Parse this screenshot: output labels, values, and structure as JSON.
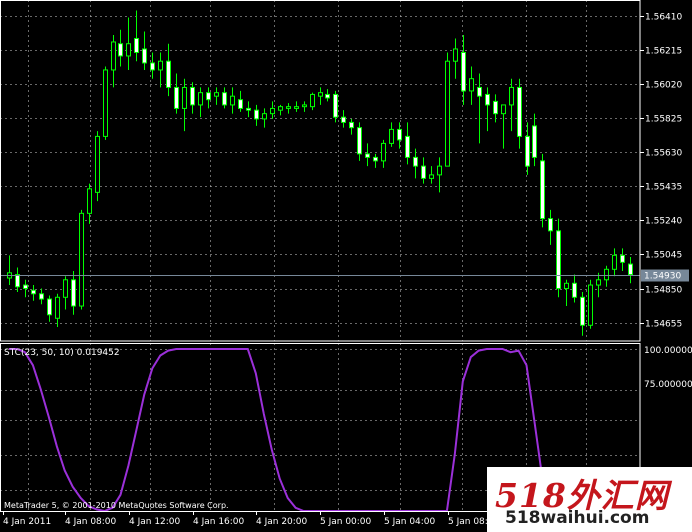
{
  "colors": {
    "background": "#000000",
    "grid": "#c0c0c0",
    "frame": "#ffffff",
    "candle": "#00ff00",
    "indicator_line": "#9b30d9",
    "current_price_line": "#778899",
    "current_price_tag_bg": "#778899",
    "watermark_red": "#c4161c"
  },
  "price_axis": {
    "labels": [
      "1.56410",
      "1.56215",
      "1.56020",
      "1.55825",
      "1.55630",
      "1.55435",
      "1.55240",
      "1.55045",
      "1.54850",
      "1.54655"
    ],
    "current_price": "1.54930"
  },
  "time_axis": {
    "labels": [
      "4 Jan 2011",
      "4 Jan 08:00",
      "4 Jan 12:00",
      "4 Jan 16:00",
      "4 Jan 20:00",
      "5 Jan 00:00",
      "5 Jan 04:00",
      "5 Jan 08:00"
    ]
  },
  "indicator": {
    "title": "STC(23, 50, 10) 0.019452",
    "axis_labels": [
      "100.000000",
      "75.000000"
    ],
    "copyright": "MetaTrader 5, © 2001-2010 MetaQuotes Software Corp."
  },
  "watermark": {
    "main_text": "518外汇网",
    "url_text": "518waihui.com"
  },
  "chart_data": {
    "type": "candlestick",
    "price_range": [
      1.5455,
      1.565
    ],
    "indicator_range": [
      0,
      100
    ],
    "candles": [
      {
        "o": 1.5491,
        "h": 1.5504,
        "l": 1.5487,
        "c": 1.5494
      },
      {
        "o": 1.5493,
        "h": 1.5497,
        "l": 1.5483,
        "c": 1.5486
      },
      {
        "o": 1.5487,
        "h": 1.549,
        "l": 1.548,
        "c": 1.5485
      },
      {
        "o": 1.5484,
        "h": 1.5487,
        "l": 1.5478,
        "c": 1.5482
      },
      {
        "o": 1.5482,
        "h": 1.5485,
        "l": 1.5476,
        "c": 1.5479
      },
      {
        "o": 1.5479,
        "h": 1.5481,
        "l": 1.5466,
        "c": 1.547
      },
      {
        "o": 1.5468,
        "h": 1.5482,
        "l": 1.5463,
        "c": 1.548
      },
      {
        "o": 1.548,
        "h": 1.5492,
        "l": 1.5473,
        "c": 1.549
      },
      {
        "o": 1.549,
        "h": 1.5495,
        "l": 1.547,
        "c": 1.5475
      },
      {
        "o": 1.5475,
        "h": 1.553,
        "l": 1.5473,
        "c": 1.5528
      },
      {
        "o": 1.5528,
        "h": 1.5545,
        "l": 1.5522,
        "c": 1.5542
      },
      {
        "o": 1.554,
        "h": 1.5575,
        "l": 1.5535,
        "c": 1.5572
      },
      {
        "o": 1.5572,
        "h": 1.5612,
        "l": 1.557,
        "c": 1.561
      },
      {
        "o": 1.561,
        "h": 1.563,
        "l": 1.56,
        "c": 1.5626
      },
      {
        "o": 1.5625,
        "h": 1.5633,
        "l": 1.5612,
        "c": 1.5618
      },
      {
        "o": 1.5618,
        "h": 1.564,
        "l": 1.561,
        "c": 1.5625
      },
      {
        "o": 1.5628,
        "h": 1.5644,
        "l": 1.5615,
        "c": 1.562
      },
      {
        "o": 1.5622,
        "h": 1.5632,
        "l": 1.561,
        "c": 1.5614
      },
      {
        "o": 1.5614,
        "h": 1.562,
        "l": 1.5605,
        "c": 1.561
      },
      {
        "o": 1.561,
        "h": 1.562,
        "l": 1.56,
        "c": 1.5615
      },
      {
        "o": 1.5615,
        "h": 1.5625,
        "l": 1.5595,
        "c": 1.56
      },
      {
        "o": 1.56,
        "h": 1.5608,
        "l": 1.5585,
        "c": 1.5588
      },
      {
        "o": 1.5588,
        "h": 1.5605,
        "l": 1.5575,
        "c": 1.56
      },
      {
        "o": 1.56,
        "h": 1.5603,
        "l": 1.5585,
        "c": 1.559
      },
      {
        "o": 1.559,
        "h": 1.56,
        "l": 1.5583,
        "c": 1.5597
      },
      {
        "o": 1.5597,
        "h": 1.56,
        "l": 1.5588,
        "c": 1.5593
      },
      {
        "o": 1.5595,
        "h": 1.56,
        "l": 1.559,
        "c": 1.5597
      },
      {
        "o": 1.5597,
        "h": 1.56,
        "l": 1.5588,
        "c": 1.559
      },
      {
        "o": 1.559,
        "h": 1.56,
        "l": 1.5585,
        "c": 1.5595
      },
      {
        "o": 1.5593,
        "h": 1.5598,
        "l": 1.5586,
        "c": 1.5588
      },
      {
        "o": 1.5588,
        "h": 1.5592,
        "l": 1.5583,
        "c": 1.5587
      },
      {
        "o": 1.5587,
        "h": 1.559,
        "l": 1.5578,
        "c": 1.5582
      },
      {
        "o": 1.5582,
        "h": 1.5588,
        "l": 1.5577,
        "c": 1.5585
      },
      {
        "o": 1.5585,
        "h": 1.5592,
        "l": 1.5582,
        "c": 1.5588
      },
      {
        "o": 1.5587,
        "h": 1.559,
        "l": 1.5584,
        "c": 1.5589
      },
      {
        "o": 1.5588,
        "h": 1.5591,
        "l": 1.5585,
        "c": 1.5589
      },
      {
        "o": 1.5588,
        "h": 1.5592,
        "l": 1.5586,
        "c": 1.5589
      },
      {
        "o": 1.5589,
        "h": 1.5592,
        "l": 1.5586,
        "c": 1.559
      },
      {
        "o": 1.5589,
        "h": 1.5597,
        "l": 1.5587,
        "c": 1.5596
      },
      {
        "o": 1.5595,
        "h": 1.56,
        "l": 1.559,
        "c": 1.5597
      },
      {
        "o": 1.5596,
        "h": 1.5599,
        "l": 1.5592,
        "c": 1.5594
      },
      {
        "o": 1.5596,
        "h": 1.5598,
        "l": 1.558,
        "c": 1.5583
      },
      {
        "o": 1.5583,
        "h": 1.5587,
        "l": 1.5577,
        "c": 1.558
      },
      {
        "o": 1.558,
        "h": 1.5582,
        "l": 1.5573,
        "c": 1.5577
      },
      {
        "o": 1.5577,
        "h": 1.558,
        "l": 1.5558,
        "c": 1.5562
      },
      {
        "o": 1.5562,
        "h": 1.5568,
        "l": 1.5555,
        "c": 1.556
      },
      {
        "o": 1.556,
        "h": 1.5562,
        "l": 1.5554,
        "c": 1.5558
      },
      {
        "o": 1.5558,
        "h": 1.557,
        "l": 1.5554,
        "c": 1.5568
      },
      {
        "o": 1.5568,
        "h": 1.558,
        "l": 1.5566,
        "c": 1.5576
      },
      {
        "o": 1.5576,
        "h": 1.558,
        "l": 1.5565,
        "c": 1.557
      },
      {
        "o": 1.5572,
        "h": 1.558,
        "l": 1.5556,
        "c": 1.556
      },
      {
        "o": 1.556,
        "h": 1.5565,
        "l": 1.5548,
        "c": 1.5555
      },
      {
        "o": 1.5555,
        "h": 1.556,
        "l": 1.5545,
        "c": 1.5548
      },
      {
        "o": 1.5548,
        "h": 1.5555,
        "l": 1.5545,
        "c": 1.555
      },
      {
        "o": 1.555,
        "h": 1.556,
        "l": 1.554,
        "c": 1.5555
      },
      {
        "o": 1.5555,
        "h": 1.562,
        "l": 1.5555,
        "c": 1.5615
      },
      {
        "o": 1.5615,
        "h": 1.5628,
        "l": 1.5605,
        "c": 1.5622
      },
      {
        "o": 1.562,
        "h": 1.563,
        "l": 1.559,
        "c": 1.5598
      },
      {
        "o": 1.5598,
        "h": 1.5612,
        "l": 1.559,
        "c": 1.5605
      },
      {
        "o": 1.56,
        "h": 1.5608,
        "l": 1.5568,
        "c": 1.5595
      },
      {
        "o": 1.5596,
        "h": 1.56,
        "l": 1.5575,
        "c": 1.559
      },
      {
        "o": 1.5592,
        "h": 1.5596,
        "l": 1.558,
        "c": 1.5585
      },
      {
        "o": 1.5585,
        "h": 1.559,
        "l": 1.5565,
        "c": 1.559
      },
      {
        "o": 1.559,
        "h": 1.5605,
        "l": 1.5575,
        "c": 1.56
      },
      {
        "o": 1.56,
        "h": 1.5605,
        "l": 1.5565,
        "c": 1.5572
      },
      {
        "o": 1.5572,
        "h": 1.558,
        "l": 1.555,
        "c": 1.5555
      },
      {
        "o": 1.5578,
        "h": 1.5585,
        "l": 1.5555,
        "c": 1.556
      },
      {
        "o": 1.5558,
        "h": 1.5562,
        "l": 1.552,
        "c": 1.5525
      },
      {
        "o": 1.5525,
        "h": 1.553,
        "l": 1.551,
        "c": 1.5518
      },
      {
        "o": 1.5518,
        "h": 1.5525,
        "l": 1.548,
        "c": 1.5485
      },
      {
        "o": 1.5485,
        "h": 1.549,
        "l": 1.5475,
        "c": 1.5488
      },
      {
        "o": 1.5488,
        "h": 1.5493,
        "l": 1.5477,
        "c": 1.548
      },
      {
        "o": 1.548,
        "h": 1.5483,
        "l": 1.5458,
        "c": 1.5464
      },
      {
        "o": 1.5464,
        "h": 1.549,
        "l": 1.5462,
        "c": 1.5487
      },
      {
        "o": 1.5487,
        "h": 1.5494,
        "l": 1.548,
        "c": 1.549
      },
      {
        "o": 1.549,
        "h": 1.5498,
        "l": 1.5486,
        "c": 1.5496
      },
      {
        "o": 1.5496,
        "h": 1.5508,
        "l": 1.5492,
        "c": 1.5504
      },
      {
        "o": 1.5504,
        "h": 1.5508,
        "l": 1.5495,
        "c": 1.55
      },
      {
        "o": 1.5499,
        "h": 1.5503,
        "l": 1.5488,
        "c": 1.5493
      }
    ],
    "stc": [
      100,
      100,
      98,
      90,
      75,
      58,
      40,
      25,
      15,
      8,
      3,
      1,
      0,
      2,
      10,
      28,
      50,
      72,
      88,
      96,
      99,
      100,
      100,
      100,
      100,
      100,
      100,
      100,
      100,
      100,
      100,
      85,
      60,
      38,
      20,
      8,
      2,
      0,
      0,
      0,
      0,
      0,
      0,
      0,
      0,
      0,
      0,
      0,
      0,
      0,
      0,
      0,
      0,
      0,
      0,
      0,
      35,
      80,
      95,
      99,
      100,
      100,
      100,
      98,
      99,
      90,
      55,
      20,
      5,
      0,
      0,
      0,
      0,
      0,
      0,
      0,
      0,
      0,
      0
    ]
  }
}
